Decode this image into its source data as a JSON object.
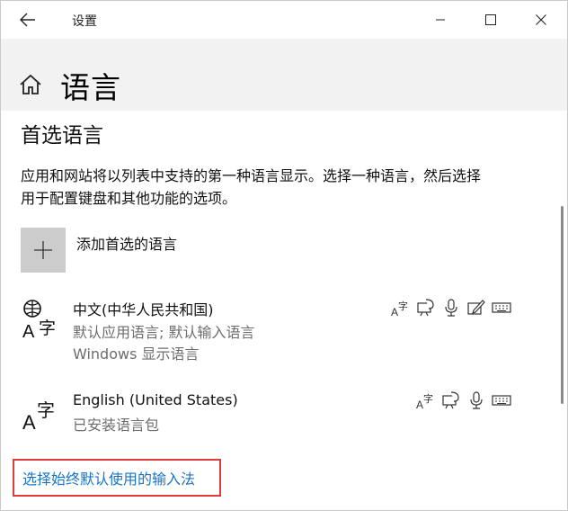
{
  "window": {
    "title": "设置"
  },
  "header": {
    "title": "语言"
  },
  "section": {
    "title": "首选语言",
    "description_line1": "应用和网站将以列表中支持的第一种语言显示。选择一种语言，然后选择",
    "description_line2": "用于配置键盘和其他功能的选项。"
  },
  "add_language": {
    "label": "添加首选的语言"
  },
  "languages": [
    {
      "name": "中文(中华人民共和国)",
      "detail1": "默认应用语言; 默认输入语言",
      "detail2": "Windows 显示语言",
      "features": [
        "language-pack-icon",
        "speech-icon",
        "microphone-icon",
        "handwriting-icon",
        "keyboard-icon"
      ]
    },
    {
      "name": "English (United States)",
      "detail1": "已安装语言包",
      "features": [
        "language-pack-icon",
        "speech-icon",
        "microphone-icon",
        "keyboard-icon"
      ]
    }
  ],
  "link": {
    "label": "选择始终默认使用的输入法"
  },
  "colors": {
    "accent_link": "#1a73c4",
    "highlight_box": "#e03c3c",
    "header_bg": "#f2f2f2"
  }
}
